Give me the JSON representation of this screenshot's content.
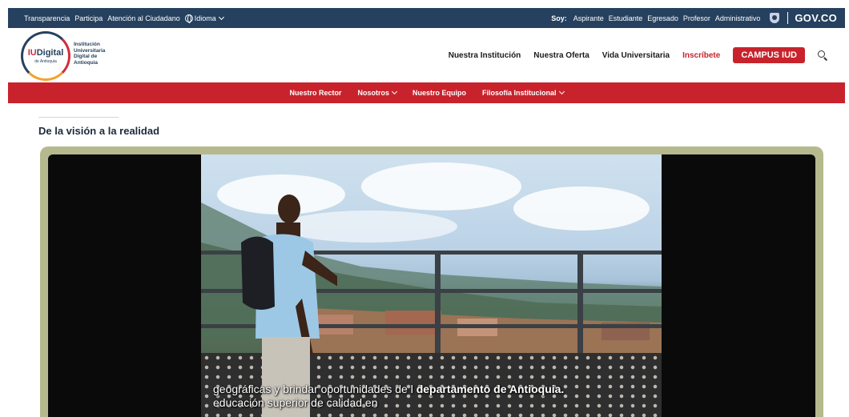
{
  "govbar": {
    "links": [
      "Transparencia",
      "Participa",
      "Atención al Ciudadano"
    ],
    "language_label": "Idioma",
    "soy_label": "Soy:",
    "audiences": [
      "Aspirante",
      "Estudiante",
      "Egresado",
      "Profesor",
      "Administrativo"
    ],
    "gov_brand": "GOV.CO",
    "bg_color": "#26415f"
  },
  "header": {
    "logo_main": "Digital",
    "logo_prefix": "IU",
    "logo_sub": "de Antioquia",
    "logo_text_lines": [
      "Institución",
      "Universitaria",
      "Digital de",
      "Antioquia"
    ],
    "nav": [
      "Nuestra Institución",
      "Nuestra Oferta",
      "Vida Universitaria"
    ],
    "inscribete_label": "Inscríbete",
    "campus_label": "CAMPUS IUD",
    "accent_color": "#c8232c"
  },
  "subnav": {
    "items": [
      {
        "label": "Nuestro Rector",
        "dropdown": false
      },
      {
        "label": "Nosotros",
        "dropdown": true
      },
      {
        "label": "Nuestro Equipo",
        "dropdown": false
      },
      {
        "label": "Filosofía Institucional",
        "dropdown": true
      }
    ]
  },
  "content": {
    "section_title": "De la visión a la realidad",
    "video": {
      "subtitle_line1_pre": "geográficas y brindar oportunidades de l ",
      "subtitle_line1_bold": "departamento de Antioquia.",
      "subtitle_line2": "educación superior de calidad en"
    }
  }
}
